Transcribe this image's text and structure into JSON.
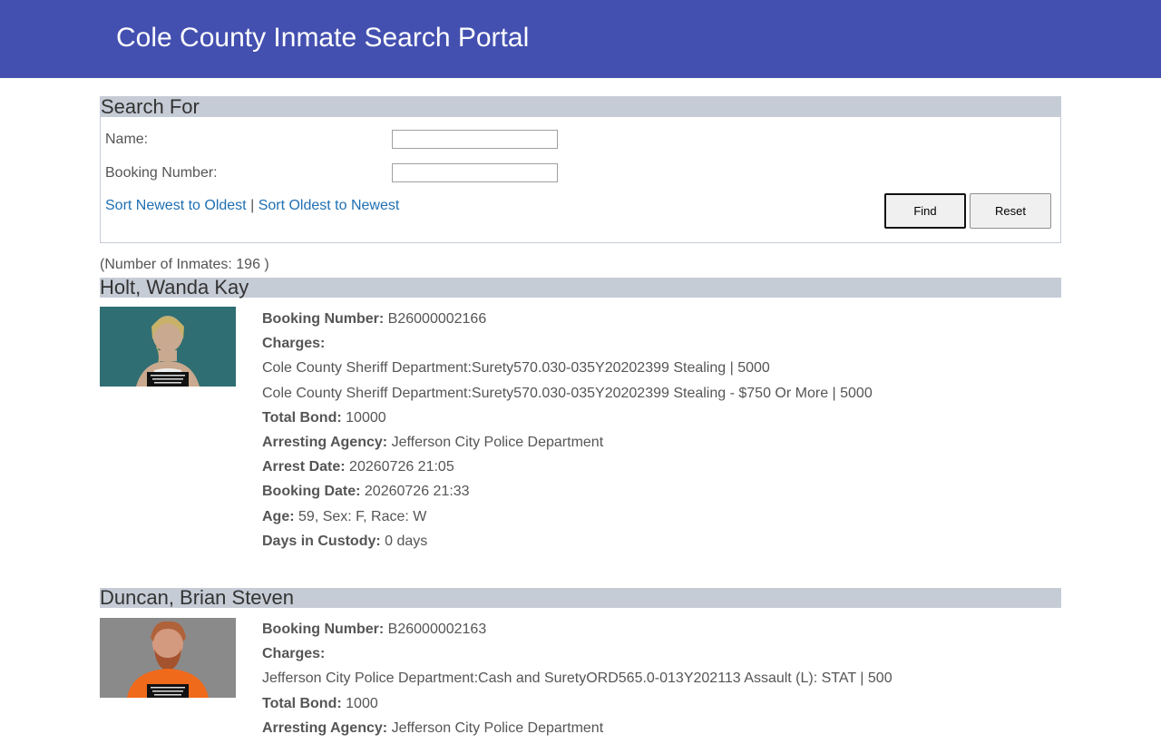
{
  "header": {
    "title": "Cole County Inmate Search Portal"
  },
  "search": {
    "section_title": "Search For",
    "name_label": "Name:",
    "name_value": "",
    "booking_label": "Booking Number:",
    "booking_value": "",
    "sort_newest": "Sort Newest to Oldest",
    "sort_separator": "|",
    "sort_oldest": "Sort Oldest to Newest",
    "find_label": "Find",
    "reset_label": "Reset"
  },
  "results": {
    "count_text": "(Number of Inmates: 196 )",
    "inmates": [
      {
        "name": "Holt, Wanda Kay",
        "booking_number_label": "Booking Number:",
        "booking_number": "B26000002166",
        "charges_label": "Charges:",
        "charges": [
          "Cole County Sheriff Department:Surety570.030-035Y20202399 Stealing | 5000",
          "Cole County Sheriff Department:Surety570.030-035Y20202399 Stealing - $750 Or More | 5000"
        ],
        "total_bond_label": "Total Bond:",
        "total_bond": "10000",
        "arresting_agency_label": "Arresting Agency:",
        "arresting_agency": "Jefferson City Police Department",
        "arrest_date_label": "Arrest Date:",
        "arrest_date": "20260726 21:05",
        "booking_date_label": "Booking Date:",
        "booking_date": "20260726 21:33",
        "age_label": "Age:",
        "age_sex_race": "59, Sex: F, Race: W",
        "days_label": "Days in Custody:",
        "days": "0 days"
      },
      {
        "name": "Duncan, Brian Steven",
        "booking_number_label": "Booking Number:",
        "booking_number": "B26000002163",
        "charges_label": "Charges:",
        "charges": [
          "Jefferson City Police Department:Cash and SuretyORD565.0-013Y202113 Assault (L): STAT | 500"
        ],
        "total_bond_label": "Total Bond:",
        "total_bond": "1000",
        "arresting_agency_label": "Arresting Agency:",
        "arresting_agency": "Jefferson City Police Department"
      }
    ]
  },
  "colors": {
    "header_bg": "#4350b0",
    "section_bar": "#c6ccd6",
    "link": "#1f6fb2"
  }
}
